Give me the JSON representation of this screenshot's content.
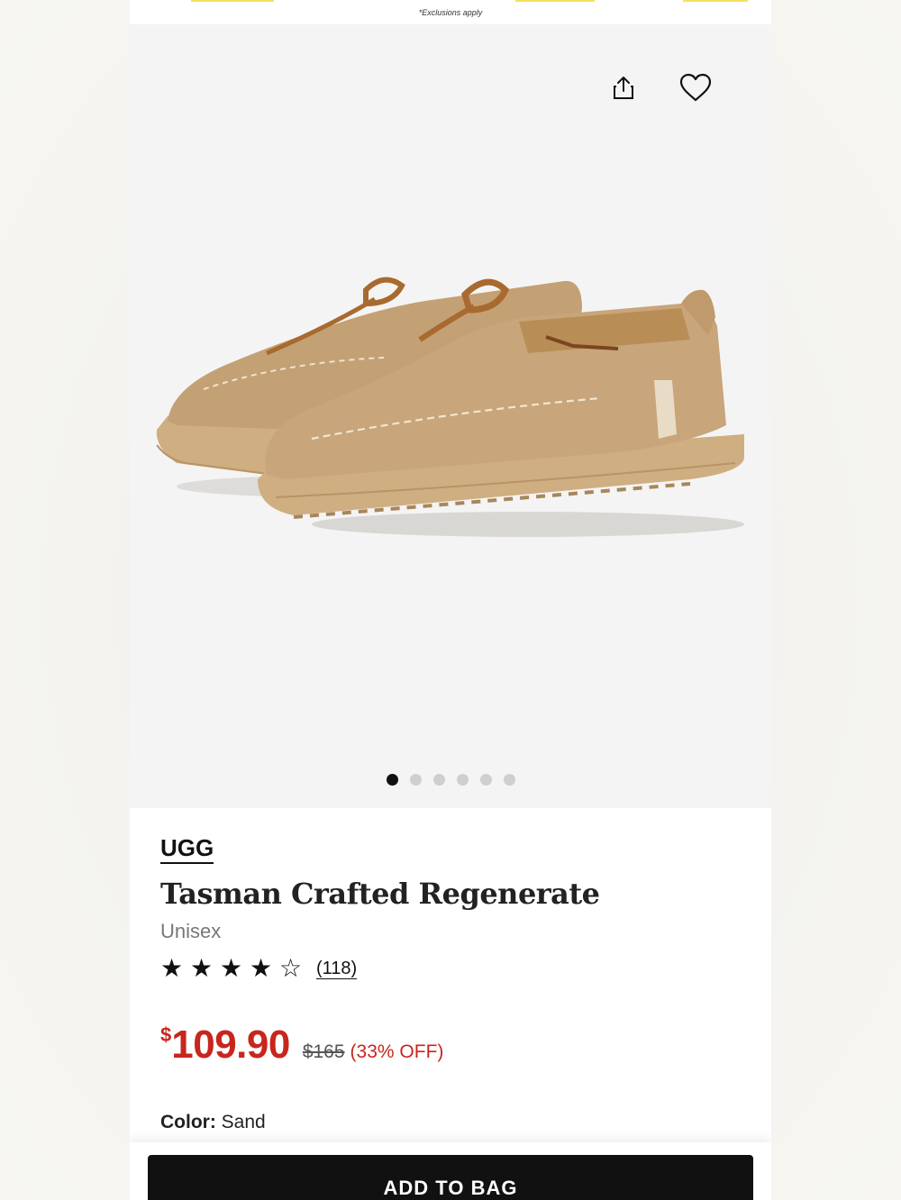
{
  "promo": {
    "exclusions": "*Exclusions apply"
  },
  "gallery": {
    "share_icon": "share-icon",
    "favorite_icon": "heart-icon",
    "image_count": 6,
    "active_index": 0
  },
  "product": {
    "brand": "UGG",
    "title": "Tasman Crafted Regenerate",
    "gender": "Unisex",
    "rating": 4,
    "rating_max": 5,
    "reviews": "(118)",
    "price_currency": "$",
    "price_amount": "109.90",
    "original_price": "$165",
    "discount": "(33% OFF)",
    "color_label": "Color:",
    "color_value": "Sand"
  },
  "actions": {
    "add_to_bag": "ADD TO BAG"
  },
  "colors": {
    "sale_red": "#c8261d",
    "button_black": "#111111",
    "promo_yellow": "#f3e35a"
  }
}
